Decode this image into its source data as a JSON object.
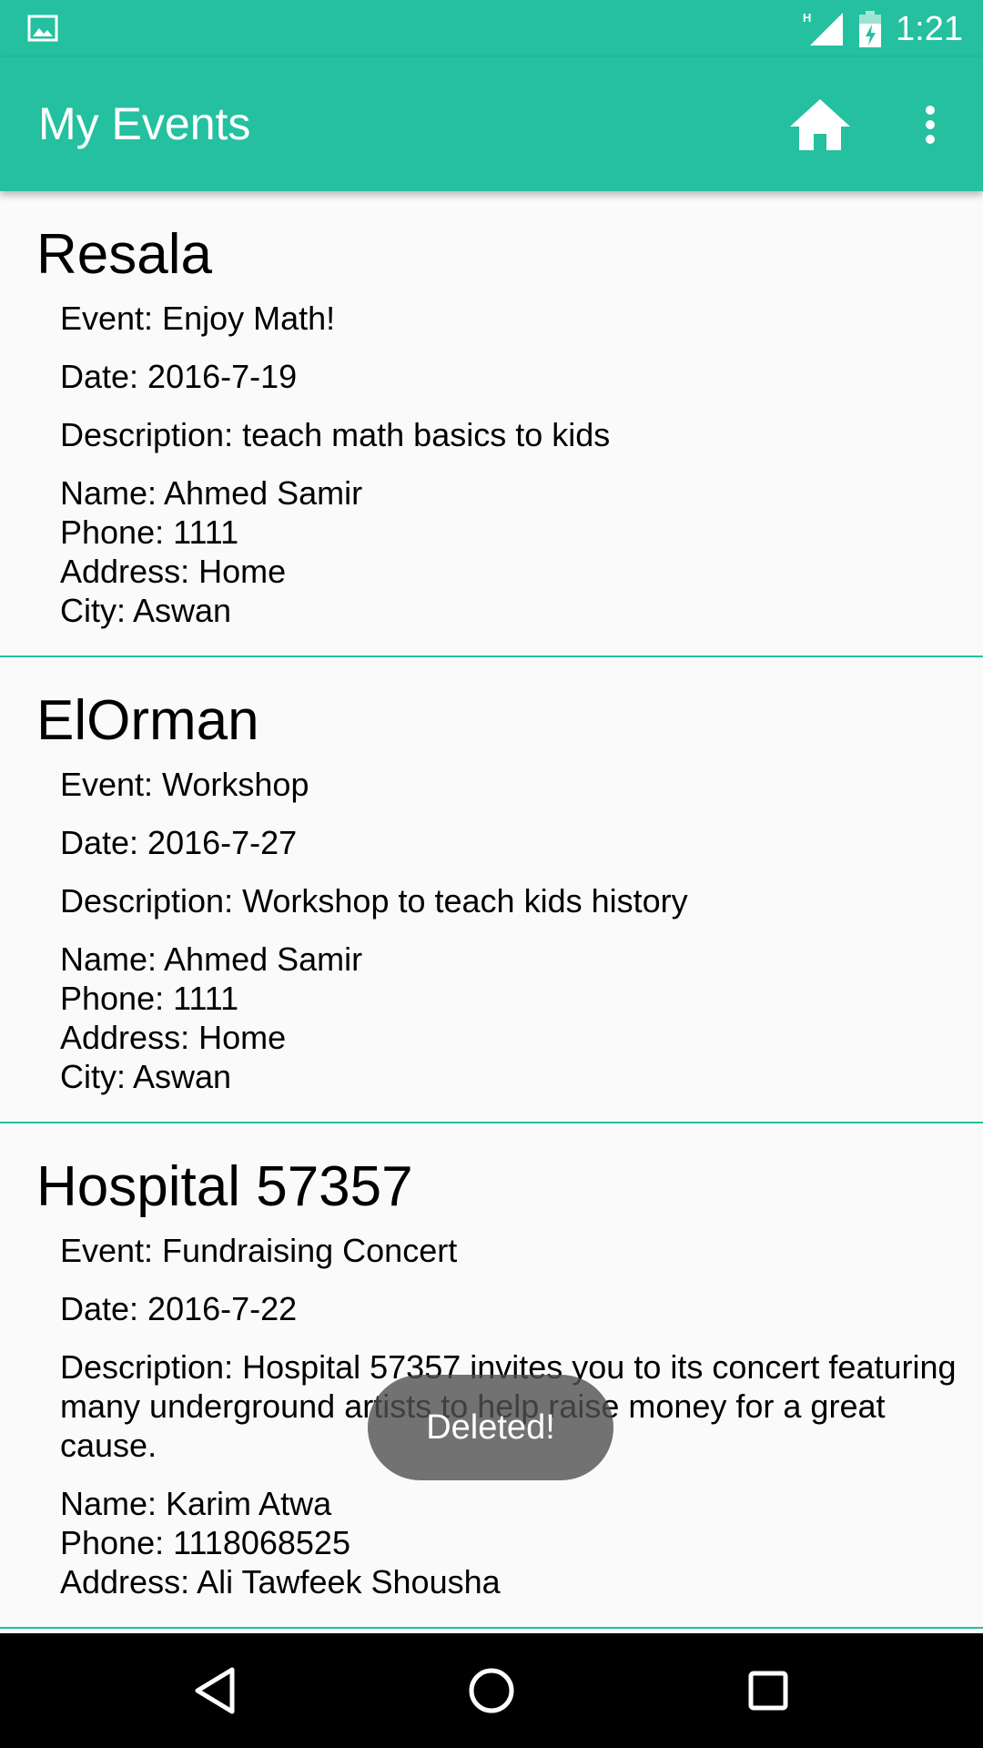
{
  "status_bar": {
    "time": "1:21",
    "network_label": "H",
    "icons": [
      "image-notification-icon",
      "signal-icon",
      "battery-charging-icon"
    ]
  },
  "app_bar": {
    "title": "My Events",
    "actions": [
      "home-icon",
      "more-vert-icon"
    ]
  },
  "events": [
    {
      "org": "Resala",
      "event": "Event: Enjoy Math!",
      "date": "Date: 2016-7-19",
      "description": "Description: teach math basics to kids",
      "name": "Name: Ahmed Samir",
      "phone": "Phone: 1111",
      "address": "Address: Home",
      "city": "City: Aswan"
    },
    {
      "org": "ElOrman",
      "event": "Event: Workshop",
      "date": "Date: 2016-7-27",
      "description": "Description: Workshop to teach kids history",
      "name": "Name: Ahmed Samir",
      "phone": "Phone: 1111",
      "address": "Address: Home",
      "city": "City: Aswan"
    },
    {
      "org": "Hospital 57357",
      "event": "Event: Fundraising Concert",
      "date": "Date: 2016-7-22",
      "description": "Description: Hospital 57357 invites you to its concert featuring many underground artists to help raise money for a great cause.",
      "name": "Name: Karim Atwa",
      "phone": "Phone: 1118068525",
      "address": "Address: Ali Tawfeek Shousha",
      "city": ""
    }
  ],
  "toast": {
    "message": "Deleted!"
  },
  "nav_bar": {
    "buttons": [
      "back-icon",
      "home-circle-icon",
      "recents-icon"
    ]
  },
  "colors": {
    "primary": "#24c09f",
    "divider": "#24c09f",
    "background": "#fafafa"
  }
}
